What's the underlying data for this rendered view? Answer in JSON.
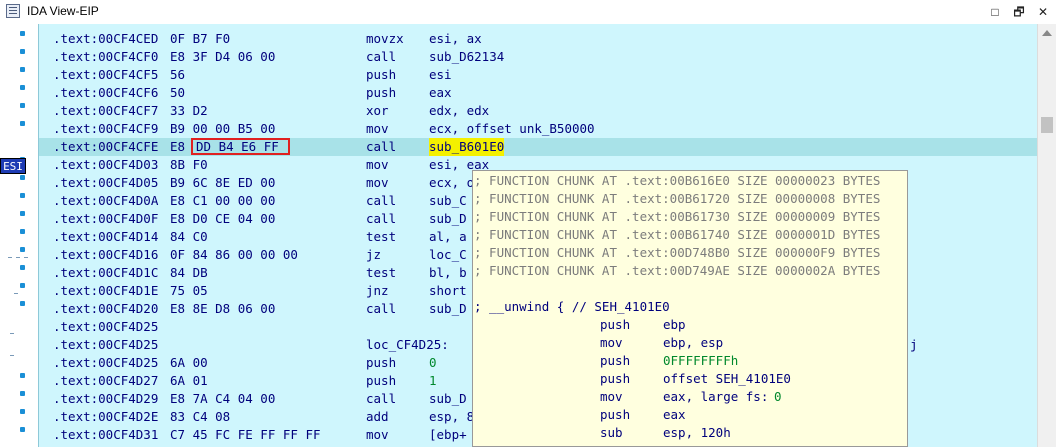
{
  "window": {
    "title": "IDA View-EIP",
    "buttons": [
      "□",
      "🗗",
      "✕"
    ]
  },
  "gutter": {
    "register_tag": "ESI"
  },
  "listing": [
    {
      "addr": ".text:00CF4CED",
      "bytes": "0F B7 F0",
      "mn": "movzx",
      "op": "esi, ax"
    },
    {
      "addr": ".text:00CF4CF0",
      "bytes": "E8 3F D4 06 00",
      "mn": "call",
      "op": "sub_D62134"
    },
    {
      "addr": ".text:00CF4CF5",
      "bytes": "56",
      "mn": "push",
      "op": "esi"
    },
    {
      "addr": ".text:00CF4CF6",
      "bytes": "50",
      "mn": "push",
      "op": "eax"
    },
    {
      "addr": ".text:00CF4CF7",
      "bytes": "33 D2",
      "mn": "xor",
      "op": "edx, edx"
    },
    {
      "addr": ".text:00CF4CF9",
      "bytes": "B9 00 00 B5 00",
      "mn": "mov",
      "op": "ecx, offset unk_B50000"
    },
    {
      "addr": ".text:00CF4CFE",
      "bytes": "E8 DD B4 E6 FF",
      "mn": "call",
      "op": "sub_B601E0"
    },
    {
      "addr": ".text:00CF4D03",
      "bytes": "8B F0",
      "mn": "mov",
      "op": "esi, eax"
    },
    {
      "addr": ".text:00CF4D05",
      "bytes": "B9 6C 8E ED 00",
      "mn": "mov",
      "op": "ecx, o"
    },
    {
      "addr": ".text:00CF4D0A",
      "bytes": "E8 C1 00 00 00",
      "mn": "call",
      "op": "sub_C"
    },
    {
      "addr": ".text:00CF4D0F",
      "bytes": "E8 D0 CE 04 00",
      "mn": "call",
      "op": "sub_D"
    },
    {
      "addr": ".text:00CF4D14",
      "bytes": "84 C0",
      "mn": "test",
      "op": "al, a"
    },
    {
      "addr": ".text:00CF4D16",
      "bytes": "0F 84 86 00 00 00",
      "mn": "jz",
      "op": "loc_C"
    },
    {
      "addr": ".text:00CF4D1C",
      "bytes": "84 DB",
      "mn": "test",
      "op": "bl, b"
    },
    {
      "addr": ".text:00CF4D1E",
      "bytes": "75 05",
      "mn": "jnz",
      "op": "short"
    },
    {
      "addr": ".text:00CF4D20",
      "bytes": "E8 8E D8 06 00",
      "mn": "call",
      "op": "sub_D"
    },
    {
      "addr": ".text:00CF4D25",
      "bytes": "",
      "mn": "",
      "op": ""
    },
    {
      "addr": ".text:00CF4D25",
      "bytes": "",
      "mn": "loc_CF4D25:",
      "op": ""
    },
    {
      "addr": ".text:00CF4D25",
      "bytes": "6A 00",
      "mn": "push",
      "op": "0"
    },
    {
      "addr": ".text:00CF4D27",
      "bytes": "6A 01",
      "mn": "push",
      "op": "1"
    },
    {
      "addr": ".text:00CF4D29",
      "bytes": "E8 7A C4 04 00",
      "mn": "call",
      "op": "sub_D"
    },
    {
      "addr": ".text:00CF4D2E",
      "bytes": "83 C4 08",
      "mn": "add",
      "op": "esp, 8"
    },
    {
      "addr": ".text:00CF4D31",
      "bytes": "C7 45 FC FE FF FF FF",
      "mn": "mov",
      "op": "[ebp+"
    }
  ],
  "current_row": {
    "addr": ".text:00CF4CFE",
    "opcode": "E8",
    "bytes_highlighted": "DD B4 E6 FF",
    "mn": "call",
    "target": "sub_B601E0"
  },
  "popup": {
    "chunks": [
      "; FUNCTION CHUNK AT .text:00B616E0 SIZE 00000023 BYTES",
      "; FUNCTION CHUNK AT .text:00B61720 SIZE 00000008 BYTES",
      "; FUNCTION CHUNK AT .text:00B61730 SIZE 00000009 BYTES",
      "; FUNCTION CHUNK AT .text:00B61740 SIZE 0000001D BYTES",
      "; FUNCTION CHUNK AT .text:00D748B0 SIZE 000000F9 BYTES",
      "; FUNCTION CHUNK AT .text:00D749AE SIZE 0000002A BYTES"
    ],
    "unwind": "; __unwind { // SEH_4101E0",
    "lines": [
      {
        "mn": "push",
        "op": "ebp",
        "green": false
      },
      {
        "mn": "mov",
        "op": "ebp, esp",
        "green": false
      },
      {
        "mn": "push",
        "op": "0FFFFFFFFh",
        "green": true
      },
      {
        "mn": "push",
        "op": "offset SEH_4101E0",
        "green": false
      },
      {
        "mn": "mov",
        "op": "eax, large fs:",
        "green": false,
        "tail": "0"
      },
      {
        "mn": "push",
        "op": "eax",
        "green": false
      },
      {
        "mn": "sub",
        "op": "esp, 120h",
        "green": false
      }
    ]
  },
  "right_edge_fragment": "j",
  "colors": {
    "listing_bg": "#cff6fd",
    "popup_bg": "#ffffdf",
    "highlight_yellow": "#f4f000",
    "box_red": "#e02020"
  }
}
